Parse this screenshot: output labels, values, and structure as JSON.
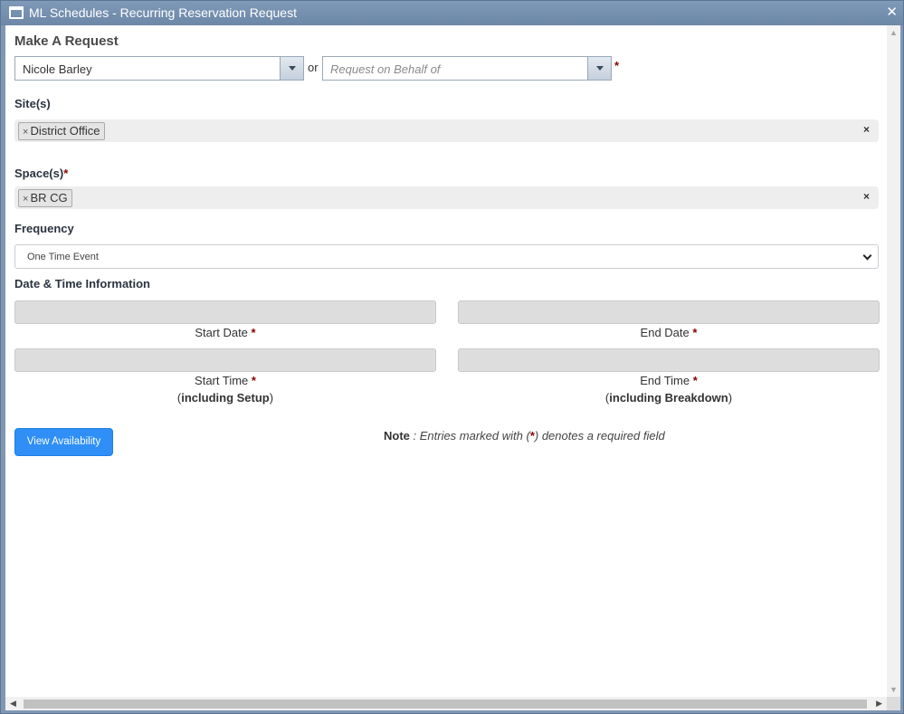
{
  "window": {
    "title": "ML Schedules - Recurring Reservation Request"
  },
  "form": {
    "heading": "Make A Request",
    "requester": {
      "value": "Nicole Barley"
    },
    "or_text": "or",
    "on_behalf": {
      "placeholder": "Request on Behalf of"
    },
    "required_mark": "*",
    "sites": {
      "label": "Site(s)",
      "tags": [
        "District Office"
      ]
    },
    "spaces": {
      "label": "Space(s)",
      "tags": [
        "BR CG"
      ]
    },
    "frequency": {
      "label": "Frequency",
      "value": "One Time Event"
    },
    "datetime": {
      "label": "Date & Time Information",
      "start_date": "Start Date",
      "end_date": "End Date",
      "start_time": "Start Time",
      "start_time_sub": "including Setup",
      "end_time": "End Time",
      "end_time_sub": "including Breakdown"
    },
    "view_button": "View Availability",
    "note": {
      "label": "Note",
      "text_before": " : Entries marked with (",
      "marker": "*",
      "text_after": ") denotes a required field"
    }
  },
  "colors": {
    "titlebar": "#7f97b3",
    "primary": "#2f8ff7",
    "required": "#8b0000"
  }
}
